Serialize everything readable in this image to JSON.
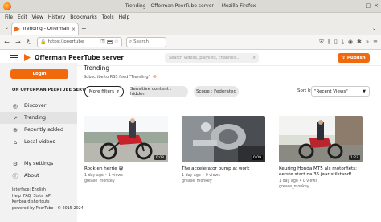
{
  "browser": {
    "window_title": "Trending - Offerman PeerTube server — Mozilla Firefox",
    "window_controls": [
      "–",
      "□",
      "×"
    ],
    "menu": [
      "File",
      "Edit",
      "View",
      "History",
      "Bookmarks",
      "Tools",
      "Help"
    ],
    "tab_title": "Trending - Offerman PeerTube",
    "tab_close": "×",
    "new_tab": "+",
    "tab_list": "⌄",
    "url": "https://peertube",
    "search_placeholder": "Search"
  },
  "header": {
    "site_name": "Offerman PeerTube server",
    "search_placeholder": "Search videos, playlists, channels...",
    "publish_label": "Publish"
  },
  "sidebar": {
    "login_label": "Login",
    "section_title": "ON OFFERMAN PEERTUBE SERVER",
    "items": [
      {
        "label": "Discover",
        "icon": "compass-icon"
      },
      {
        "label": "Trending",
        "icon": "trending-icon"
      },
      {
        "label": "Recently added",
        "icon": "plus-icon"
      },
      {
        "label": "Local videos",
        "icon": "home-icon"
      }
    ],
    "items2": [
      {
        "label": "My settings",
        "icon": "gear-icon"
      },
      {
        "label": "About",
        "icon": "info-icon"
      }
    ],
    "footer": {
      "interface": "Interface: English",
      "links1": [
        "Help",
        "FAQ",
        "Stats",
        "API"
      ],
      "links2": "Keyboard shortcuts",
      "powered": "powered by PeerTube - © 2015-2024"
    }
  },
  "page": {
    "title": "Trending",
    "rss_text": "Subscribe to RSS feed \"Trending\"",
    "filters": {
      "more_label": "More filters",
      "chip1": "Sensitive content : hidden",
      "chip2": "Scope : Federated"
    },
    "sort_label": "Sort by",
    "sort_value": "\"Recent Views\""
  },
  "videos": [
    {
      "title": "Rook en herrie 😅",
      "duration": "0:08",
      "age": "1 day ago • 1 views",
      "author": "grease_monkey"
    },
    {
      "title": "The accelerator pump at work",
      "duration": "0:09",
      "age": "1 day ago • 0 views",
      "author": "grease_monkey"
    },
    {
      "title": "Keuring Honda MT5 als motorfiets: eerste start na 35 jaar stilstand!",
      "duration": "1:27",
      "age": "1 day ago • 0 views",
      "author": "grease_monkey"
    }
  ],
  "colors": {
    "brand": "#f1680d"
  }
}
